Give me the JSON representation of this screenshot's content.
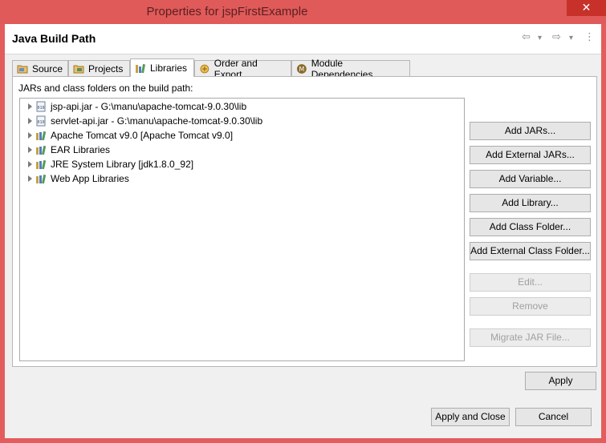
{
  "window": {
    "title": "Properties for jspFirstExample",
    "close_label": "✕"
  },
  "header": {
    "title": "Java Build Path",
    "back_icon": "⇦",
    "dropdown_icon": "▾",
    "forward_icon": "⇨",
    "menu_icon": "⋮"
  },
  "tabs": [
    {
      "label": "Source",
      "icon": "source-folder-icon"
    },
    {
      "label": "Projects",
      "icon": "projects-folder-icon"
    },
    {
      "label": "Libraries",
      "icon": "libraries-icon"
    },
    {
      "label": "Order and Export",
      "icon": "order-export-icon"
    },
    {
      "label": "Module Dependencies",
      "icon": "module-icon"
    }
  ],
  "panel": {
    "label": "JARs and class folders on the build path:",
    "entries": [
      {
        "label": "jsp-api.jar - G:\\manu\\apache-tomcat-9.0.30\\lib",
        "icon": "jar-icon"
      },
      {
        "label": "servlet-api.jar - G:\\manu\\apache-tomcat-9.0.30\\lib",
        "icon": "jar-icon"
      },
      {
        "label": "Apache Tomcat v9.0 [Apache Tomcat v9.0]",
        "icon": "library-icon"
      },
      {
        "label": "EAR Libraries",
        "icon": "library-icon"
      },
      {
        "label": "JRE System Library [jdk1.8.0_92]",
        "icon": "library-icon"
      },
      {
        "label": "Web App Libraries",
        "icon": "library-icon"
      }
    ]
  },
  "buttons": {
    "add_jars": "Add JARs...",
    "add_external_jars": "Add External JARs...",
    "add_variable": "Add Variable...",
    "add_library": "Add Library...",
    "add_class_folder": "Add Class Folder...",
    "add_external_class_folder": "Add External Class Folder...",
    "edit": "Edit...",
    "remove": "Remove",
    "migrate_jar": "Migrate JAR File..."
  },
  "footer": {
    "apply": "Apply",
    "apply_and_close": "Apply and Close",
    "cancel": "Cancel"
  },
  "colors": {
    "titlebar": "#e05a5a",
    "close": "#c7312a",
    "focus": "#3c7fb1"
  }
}
